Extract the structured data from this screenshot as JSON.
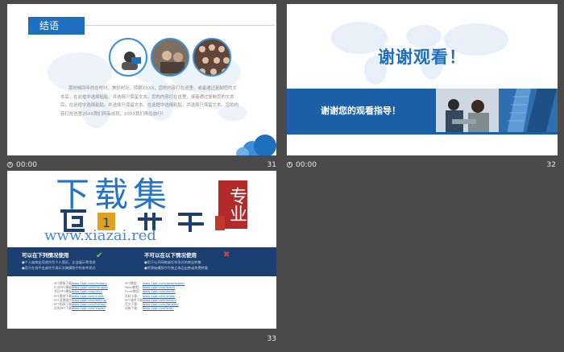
{
  "slides": [
    {
      "number": "31",
      "time": "00:00",
      "title": "结语",
      "body": "那时候四年的在校时，美好时光，转眼XXXX，您的内容打在这里，或者通过复制您的文本后，在此框中选择粘贴，并选择只保留文本。您的内容打在这里，或者通过复制您的文本后，在此框中选择粘贴，并选择只保留文本。在此框中选择粘贴，并选择只保留文本。您的内容打在这里20XX我们所有成员，20XX我们再往前行！"
    },
    {
      "number": "32",
      "time": "00:00",
      "headline": "谢谢观看！",
      "band_text": "谢谢您的观看指导！"
    },
    {
      "number": "33",
      "watermark": {
        "chars": "下载集",
        "seal": "专业",
        "url": "www.xiazai.red"
      },
      "can_use_title": "可以在下列情况使用",
      "can_use_lines": [
        "●个人或商业用途作为个人简历、企业展示等用途",
        "●用于在线平台或作为演示文稿模版中的参考样式"
      ],
      "cannot_use_title": "不可以在以下情况使用",
      "cannot_use_lines": [
        "●用于公开网络或任何形式的商业转售",
        "●将原始模版作为独立商品出售或免费转载"
      ],
      "refs_left": [
        {
          "k": "PPT模板下载：",
          "v": "www.1ppt.com/moban/"
        },
        {
          "k": "行业PPT模板：",
          "v": "www.1ppt.com/hangye/"
        },
        {
          "k": "节日PPT模板：",
          "v": "www.1ppt.com/jieri/"
        },
        {
          "k": "PPT素材下载：",
          "v": "www.1ppt.com/sucai/"
        },
        {
          "k": "PPT背景图片：",
          "v": "www.1ppt.com/beijing/"
        },
        {
          "k": "PPT图表下载：",
          "v": "www.1ppt.com/tubiao/"
        },
        {
          "k": "优秀PPT下载：",
          "v": "www.1ppt.com/xiazai/"
        }
      ],
      "refs_right": [
        {
          "k": "PPT教程：",
          "v": "www.1ppt.com/powerpoint/"
        },
        {
          "k": "Word教程：",
          "v": "www.1ppt.com/word/"
        },
        {
          "k": "Excel教程：",
          "v": "www.1ppt.com/excel/"
        },
        {
          "k": "资料下载：",
          "v": "www.1ppt.com/ziliao/"
        },
        {
          "k": "PPT课件下载：",
          "v": "www.1ppt.com/kejian/"
        },
        {
          "k": "范文下载：",
          "v": "www.1ppt.com/fanwen/"
        },
        {
          "k": "试卷下载：",
          "v": "www.1ppt.com/shiti/"
        }
      ]
    }
  ],
  "colors": {
    "accent": "#1f6fc1",
    "dark_band": "#1a3f70",
    "background": "#4a4a4a"
  }
}
